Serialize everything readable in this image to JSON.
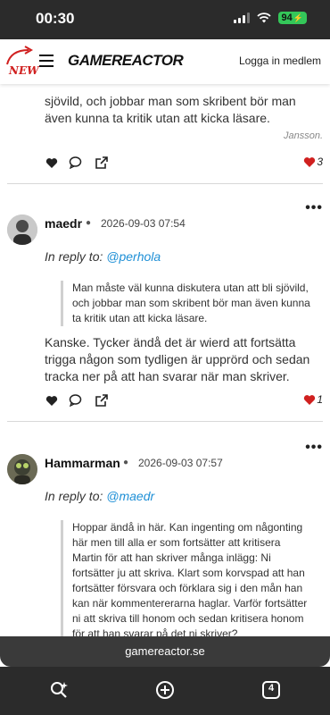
{
  "status_bar": {
    "time": "00:30",
    "battery": "94"
  },
  "header": {
    "logo": "GAMEREACTOR",
    "new_badge": "NEW",
    "login_label": "Logga in medlem"
  },
  "previous_comment": {
    "text": "sjövild, och jobbar man som skribent bör man även kunna ta kritik utan att kicka läsare.",
    "signature": "Jansson.",
    "likes": "3"
  },
  "comments": [
    {
      "username": "maedr",
      "datetime": "2026-09-03 07:54",
      "reply_prefix": "In reply to:",
      "reply_to": "@perhola",
      "quote": "Man måste väl kunna diskutera utan att bli sjövild, och jobbar man som skribent bör man även kunna ta kritik utan att kicka läsare.",
      "text": "Kanske. Tycker ändå det är wierd att fortsätta trigga någon som tydligen är upprörd och sedan tracka ner på att han svarar när man skriver.",
      "likes": "1"
    },
    {
      "username": "Hammarman",
      "datetime": "2026-09-03 07:57",
      "reply_prefix": "In reply to:",
      "reply_to": "@maedr",
      "quote": "Hoppar ändå in här. Kan ingenting om någonting här men till alla er som fortsätter att kritisera Martin för att han skriver många inlägg: Ni fortsätter ju att skriva. Klart som korvspad att han fortsätter försvara och förklara sig i den mån han kan när kommentererarna haglar. Varför fortsätter ni att skriva till honom och sedan kritisera honom för att han svarar på det ni skriver?"
    }
  ],
  "browser": {
    "url": "gamereactor.se",
    "tab_count": "4"
  },
  "colors": {
    "accent_link": "#1e8fd6",
    "like_heart": "#d0201f",
    "battery": "#34c759"
  }
}
